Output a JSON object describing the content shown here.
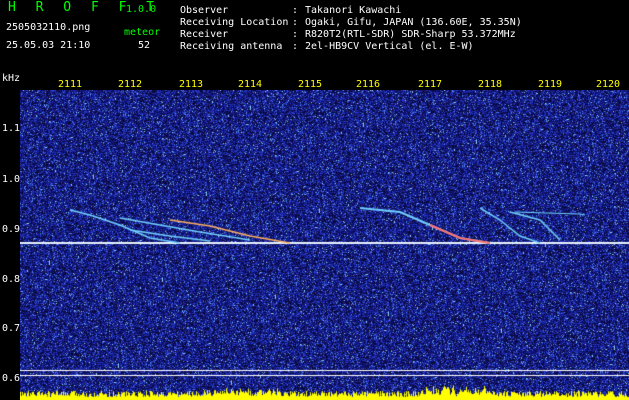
{
  "app": {
    "logo": "H R O F F T",
    "version": "1.0.0"
  },
  "file": {
    "name": "2505032110.png",
    "datetime": "25.05.03 21:10"
  },
  "meteor": {
    "label": "meteor",
    "count": "52"
  },
  "info": [
    {
      "key": "Observer",
      "value": "Takanori Kawachi"
    },
    {
      "key": "Receiving Location",
      "value": "Ogaki, Gifu, JAPAN (136.60E, 35.35N)"
    },
    {
      "key": "Receiver",
      "value": "R820T2(RTL-SDR) SDR-Sharp 53.372MHz"
    },
    {
      "key": "Receiving antenna",
      "value": "2el-HB9CV Vertical (el. E-W)"
    }
  ],
  "info_separator": ":",
  "axis": {
    "unit": "kHz",
    "y_ticks": [
      "1.1",
      "1.0",
      "0.9",
      "0.8",
      "0.7",
      "0.6"
    ],
    "x_ticks": [
      "2111",
      "2112",
      "2113",
      "2114",
      "2115",
      "2116",
      "2117",
      "2118",
      "2119",
      "2120"
    ]
  },
  "colors": {
    "background": "#000000",
    "logo": "#00ff00",
    "time_ticks": "#ffff00",
    "noise": "#1a1a8c",
    "carrier": "#ffffff",
    "echo": "#66ccff",
    "level_bar": "#ffff00"
  }
}
